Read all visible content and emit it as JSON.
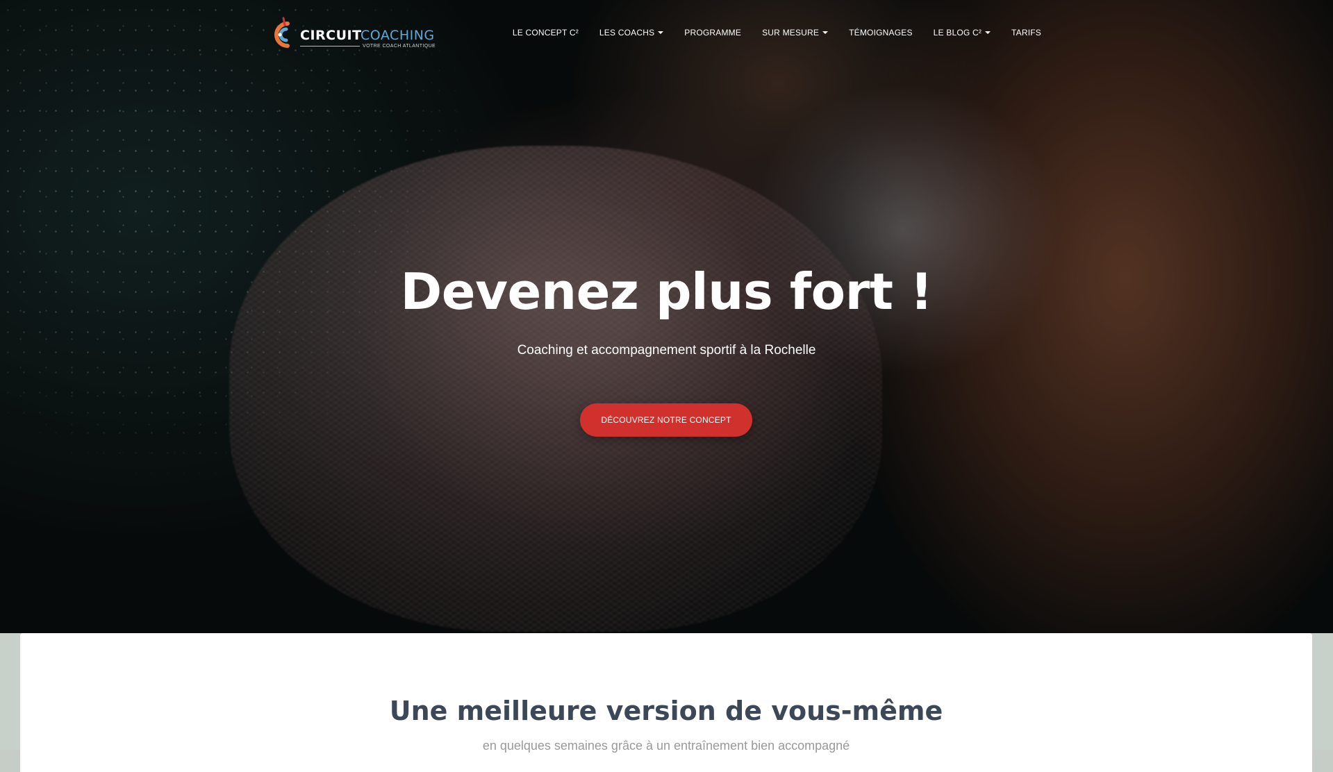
{
  "brand": {
    "name_part1": "CIRCUIT",
    "name_part2": "COACHING",
    "tagline": "VOTRE COACH ATLANTIQUE",
    "colors": {
      "accent_red": "#d0312d",
      "accent_blue": "#5fa9d8",
      "accent_orange": "#e8763a"
    }
  },
  "nav": {
    "items": [
      {
        "label": "LE CONCEPT C²",
        "has_dropdown": false
      },
      {
        "label": "LES COACHS",
        "has_dropdown": true
      },
      {
        "label": "PROGRAMME",
        "has_dropdown": false
      },
      {
        "label": "SUR MESURE",
        "has_dropdown": true
      },
      {
        "label": "TÉMOIGNAGES",
        "has_dropdown": false
      },
      {
        "label": "LE BLOG C²",
        "has_dropdown": true
      },
      {
        "label": "TARIFS",
        "has_dropdown": false
      }
    ]
  },
  "hero": {
    "title": "Devenez plus fort !",
    "subtitle": "Coaching et accompagnement sportif à la Rochelle",
    "cta_label": "DÉCOUVREZ NOTRE CONCEPT"
  },
  "section": {
    "title": "Une meilleure version de vous-même",
    "subtitle": "en quelques semaines grâce à un entraînement bien accompagné"
  }
}
